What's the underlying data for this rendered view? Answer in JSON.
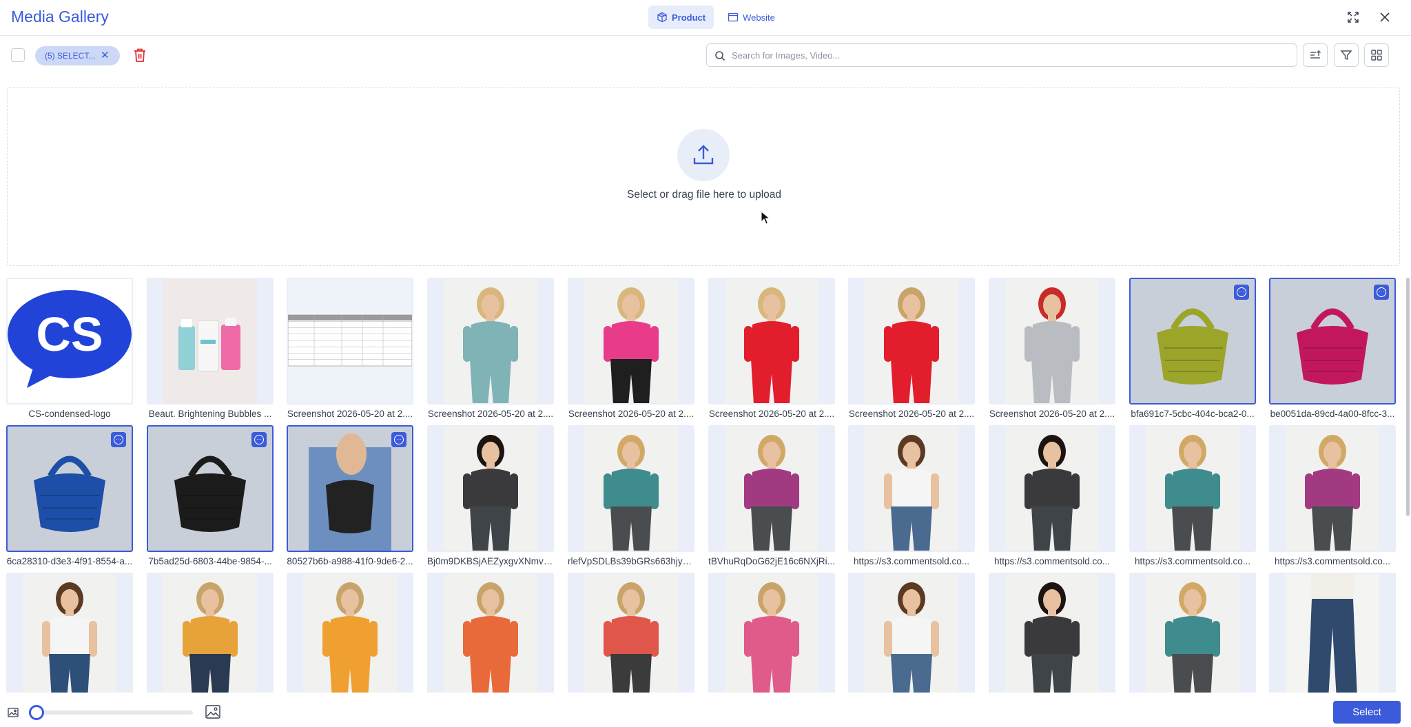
{
  "header": {
    "title": "Media Gallery",
    "tabs": [
      {
        "label": "Product",
        "active": true,
        "icon": "box-icon"
      },
      {
        "label": "Website",
        "active": false,
        "icon": "browser-window-icon"
      }
    ],
    "expand_icon": "expand-icon",
    "close_icon": "close-icon"
  },
  "toolbar": {
    "selection_chip": "(5) SELECT...",
    "search_placeholder": "Search for Images, Video...",
    "sort_icon": "sort-icon",
    "filter_icon": "filter-icon",
    "grid_icon": "grid-view-icon"
  },
  "upload": {
    "text": "Select or drag file here to upload"
  },
  "grid": {
    "items": [
      {
        "caption": "CS-condensed-logo",
        "selected": false,
        "kind": "logo"
      },
      {
        "caption": "Beaut. Brightening Bubbles ...",
        "selected": false,
        "kind": "bottles"
      },
      {
        "caption": "Screenshot 2026-05-20 at 2....",
        "selected": false,
        "kind": "sizechart"
      },
      {
        "caption": "Screenshot 2026-05-20 at 2....",
        "selected": false,
        "kind": "person",
        "top": "#7fb3b5",
        "bottom": "#7fb3b5",
        "hair": "#d9b77c"
      },
      {
        "caption": "Screenshot 2026-05-20 at 2....",
        "selected": false,
        "kind": "person",
        "top": "#e83c8a",
        "bottom": "#1f1f1f",
        "hair": "#d9b77c"
      },
      {
        "caption": "Screenshot 2026-05-20 at 2....",
        "selected": false,
        "kind": "person",
        "top": "#e21d2c",
        "bottom": "#e21d2c",
        "hair": "#d9b77c"
      },
      {
        "caption": "Screenshot 2026-05-20 at 2....",
        "selected": false,
        "kind": "person",
        "top": "#e21d2c",
        "bottom": "#e21d2c",
        "hair": "#c9a46a"
      },
      {
        "caption": "Screenshot 2026-05-20 at 2....",
        "selected": false,
        "kind": "person",
        "top": "#b9bcc0",
        "bottom": "#b9bcc0",
        "hair": "#c92a2a"
      },
      {
        "caption": "bfa691c7-5cbc-404c-bca2-0...",
        "selected": true,
        "kind": "bag",
        "color": "#9aa52a"
      },
      {
        "caption": "be0051da-89cd-4a00-8fcc-3...",
        "selected": true,
        "kind": "bag",
        "color": "#c2185b"
      },
      {
        "caption": "6ca28310-d3e3-4f91-8554-a...",
        "selected": true,
        "kind": "bag",
        "color": "#1d4fa8"
      },
      {
        "caption": "7b5ad25d-6803-44be-9854-...",
        "selected": true,
        "kind": "bag",
        "color": "#1b1b1b"
      },
      {
        "caption": "80527b6b-a988-41f0-9de6-2...",
        "selected": true,
        "kind": "bag-hand",
        "color": "#222"
      },
      {
        "caption": "Bj0m9DKBSjAEZyxgvXNmvJ...",
        "selected": false,
        "kind": "person",
        "top": "#3a3a3d",
        "bottom": "#3f4448",
        "hair": "#1c1410"
      },
      {
        "caption": "rlefVpSDLBs39bGRs663hjyK...",
        "selected": false,
        "kind": "person",
        "top": "#3f8c8f",
        "bottom": "#4a4d50",
        "hair": "#d2a867"
      },
      {
        "caption": "tBVhuRqDoG62jE16c6NXjRi...",
        "selected": false,
        "kind": "person",
        "top": "#a23a82",
        "bottom": "#4a4d50",
        "hair": "#d2a867"
      },
      {
        "caption": "https://s3.commentsold.co...",
        "selected": false,
        "kind": "person",
        "top": "#f5f5f5",
        "bottom": "#4b6a8f",
        "hair": "#5a3a22"
      },
      {
        "caption": "https://s3.commentsold.co...",
        "selected": false,
        "kind": "person",
        "top": "#3a3a3d",
        "bottom": "#3f4448",
        "hair": "#1c1410"
      },
      {
        "caption": "https://s3.commentsold.co...",
        "selected": false,
        "kind": "person",
        "top": "#3f8c8f",
        "bottom": "#4a4d50",
        "hair": "#d2a867"
      },
      {
        "caption": "https://s3.commentsold.co...",
        "selected": false,
        "kind": "person",
        "top": "#a23a82",
        "bottom": "#4a4d50",
        "hair": "#d2a867"
      },
      {
        "caption": "",
        "selected": false,
        "kind": "person",
        "top": "#f5f5f5",
        "bottom": "#2d4f78",
        "hair": "#5a3a22"
      },
      {
        "caption": "",
        "selected": false,
        "kind": "person",
        "top": "#e8a23a",
        "bottom": "#2a3a52",
        "hair": "#c9a46a"
      },
      {
        "caption": "",
        "selected": false,
        "kind": "person",
        "top": "#f0a030",
        "bottom": "#f0a030",
        "hair": "#c9a46a"
      },
      {
        "caption": "",
        "selected": false,
        "kind": "person",
        "top": "#e86a3a",
        "bottom": "#e86a3a",
        "hair": "#c9a46a"
      },
      {
        "caption": "",
        "selected": false,
        "kind": "person",
        "top": "#e0564a",
        "bottom": "#3b3b3b",
        "hair": "#c9a46a"
      },
      {
        "caption": "",
        "selected": false,
        "kind": "person",
        "top": "#e05a8a",
        "bottom": "#e05a8a",
        "hair": "#c9a46a"
      },
      {
        "caption": "",
        "selected": false,
        "kind": "person",
        "top": "#f5f5f5",
        "bottom": "#4b6a8f",
        "hair": "#5a3a22"
      },
      {
        "caption": "",
        "selected": false,
        "kind": "person",
        "top": "#3a3a3d",
        "bottom": "#3f4448",
        "hair": "#1c1410"
      },
      {
        "caption": "",
        "selected": false,
        "kind": "person",
        "top": "#3f8c8f",
        "bottom": "#4a4d50",
        "hair": "#d2a867"
      },
      {
        "caption": "",
        "selected": false,
        "kind": "jeans",
        "top": "#f2efe8",
        "bottom": "#2f4a6d",
        "hair": "#d2a867"
      }
    ]
  },
  "footer": {
    "small_image_icon": "image-small-icon",
    "large_image_icon": "image-large-icon",
    "zoom_level": 0,
    "select_label": "Select"
  },
  "colors": {
    "accent": "#3b5bdb",
    "danger": "#e03131",
    "selected_border": "#3b5bdb"
  }
}
